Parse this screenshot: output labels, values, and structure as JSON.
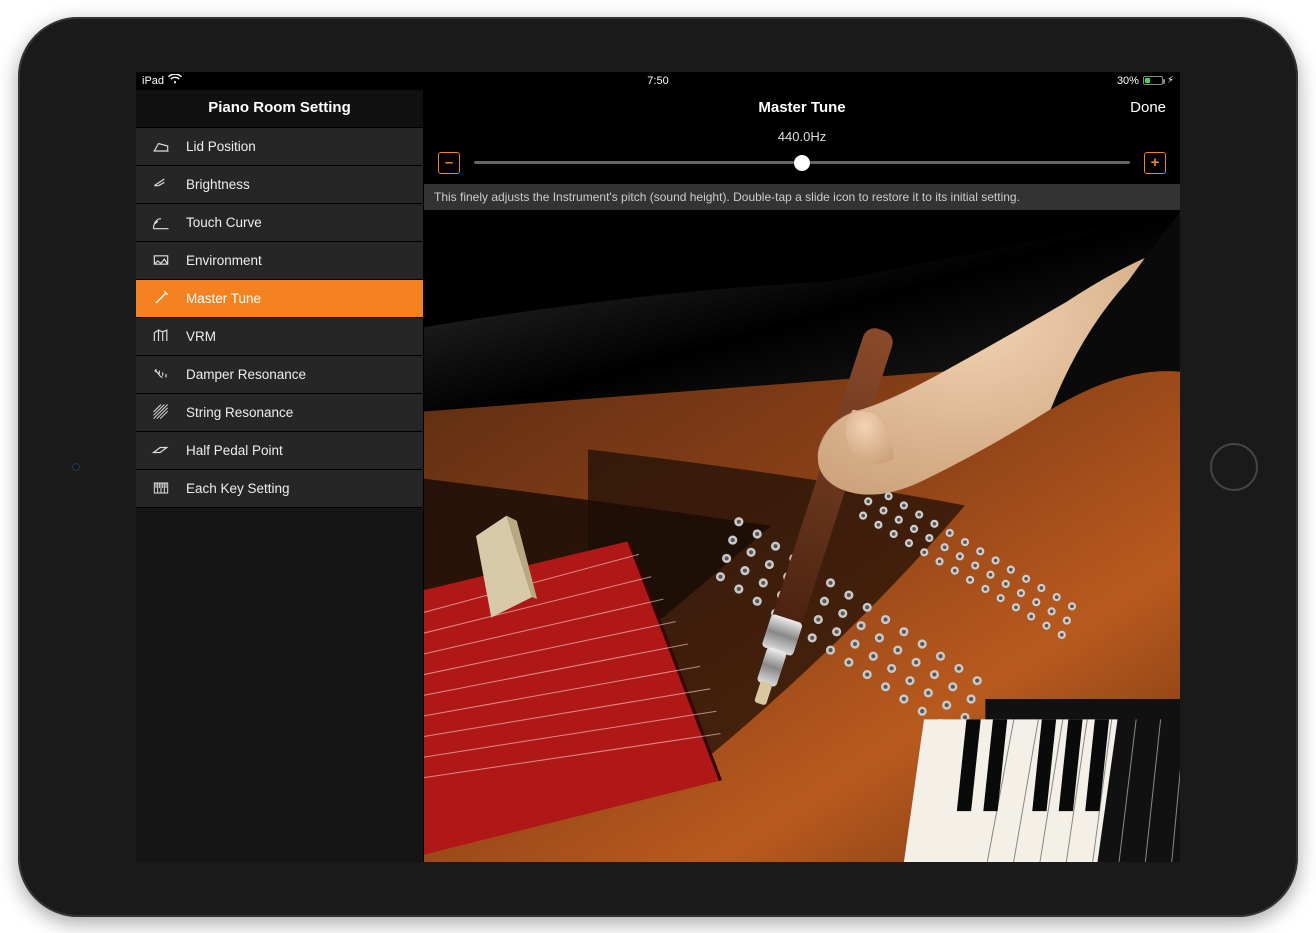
{
  "status": {
    "device": "iPad",
    "time": "7:50",
    "battery_text": "30%",
    "battery_pct": 30
  },
  "sidebar": {
    "title": "Piano Room Setting",
    "items": [
      {
        "icon": "lid-icon",
        "label": "Lid Position"
      },
      {
        "icon": "brightness-icon",
        "label": "Brightness"
      },
      {
        "icon": "touch-icon",
        "label": "Touch Curve"
      },
      {
        "icon": "environment-icon",
        "label": "Environment"
      },
      {
        "icon": "tune-icon",
        "label": "Master Tune"
      },
      {
        "icon": "vrm-icon",
        "label": "VRM"
      },
      {
        "icon": "damper-icon",
        "label": "Damper Resonance"
      },
      {
        "icon": "string-icon",
        "label": "String Resonance"
      },
      {
        "icon": "pedal-icon",
        "label": "Half Pedal Point"
      },
      {
        "icon": "eachkey-icon",
        "label": "Each Key Setting"
      }
    ],
    "active_index": 4
  },
  "main": {
    "title": "Master Tune",
    "done": "Done",
    "value_text": "440.0Hz",
    "slider_pct": 50,
    "minus": "–",
    "plus": "+",
    "description": "This finely adjusts the Instrument's pitch (sound height). Double-tap a slide icon to restore it to its initial setting."
  }
}
